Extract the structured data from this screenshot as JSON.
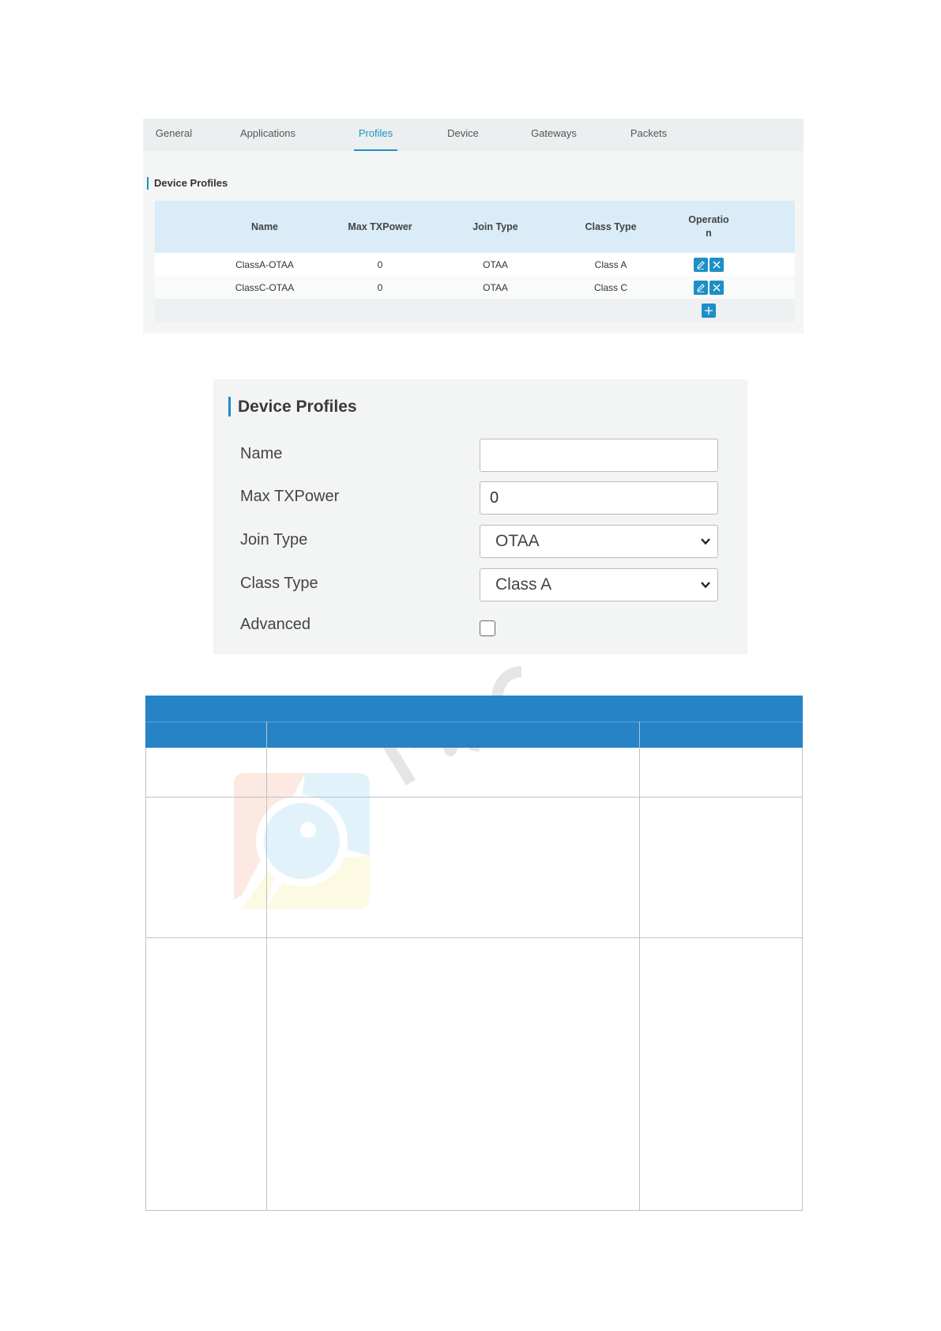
{
  "tabs": [
    {
      "label": "General",
      "active": false
    },
    {
      "label": "Applications",
      "active": false
    },
    {
      "label": "Profiles",
      "active": true
    },
    {
      "label": "Device",
      "active": false
    },
    {
      "label": "Gateways",
      "active": false
    },
    {
      "label": "Packets",
      "active": false
    }
  ],
  "profiles_table": {
    "section_title": "Device Profiles",
    "columns": [
      "Name",
      "Max TXPower",
      "Join Type",
      "Class Type",
      "Operation"
    ],
    "rows": [
      {
        "name": "ClassA-OTAA",
        "max_txpower": "0",
        "join_type": "OTAA",
        "class_type": "Class A"
      },
      {
        "name": "ClassC-OTAA",
        "max_txpower": "0",
        "join_type": "OTAA",
        "class_type": "Class C"
      }
    ],
    "row_icons": [
      "edit-icon",
      "delete-icon"
    ],
    "add_icon": "add-icon"
  },
  "profile_form": {
    "section_title": "Device Profiles",
    "name_label": "Name",
    "name_value": "",
    "max_txpower_label": "Max TXPower",
    "max_txpower_value": "0",
    "join_type_label": "Join Type",
    "join_type_value": "OTAA",
    "class_type_label": "Class Type",
    "class_type_value": "Class A",
    "advanced_label": "Advanced",
    "advanced_checked": false
  },
  "colors": {
    "accent": "#1d8fc6",
    "table_header": "#d9ecf7",
    "blue_table_header": "#2683c6"
  }
}
